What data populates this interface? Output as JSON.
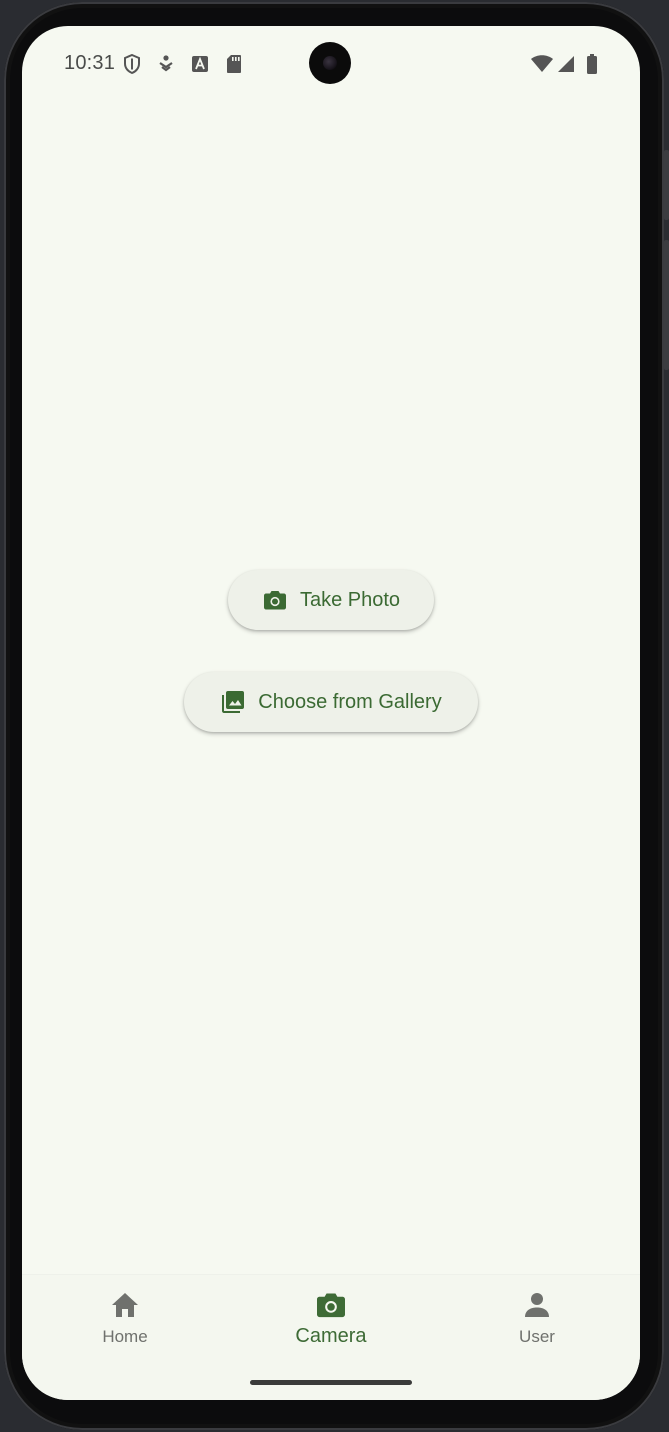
{
  "status_bar": {
    "time": "10:31",
    "left_icons": [
      "shield-icon",
      "nfc-pay-icon",
      "font-a-icon",
      "sd-card-icon"
    ],
    "right_icons": [
      "wifi-icon",
      "cellular-signal-icon",
      "battery-icon"
    ]
  },
  "actions": {
    "take_photo_label": "Take Photo",
    "take_photo_icon": "camera-icon",
    "gallery_label": "Choose from Gallery",
    "gallery_icon": "photo-library-icon"
  },
  "bottom_nav": {
    "items": [
      {
        "label": "Home",
        "icon": "home-icon",
        "active": false
      },
      {
        "label": "Camera",
        "icon": "camera-icon",
        "active": true
      },
      {
        "label": "User",
        "icon": "person-icon",
        "active": false
      }
    ]
  },
  "colors": {
    "background": "#f6f9f1",
    "accent": "#3e6b36",
    "button_background": "#eef1e9",
    "inactive": "#6f716d"
  }
}
